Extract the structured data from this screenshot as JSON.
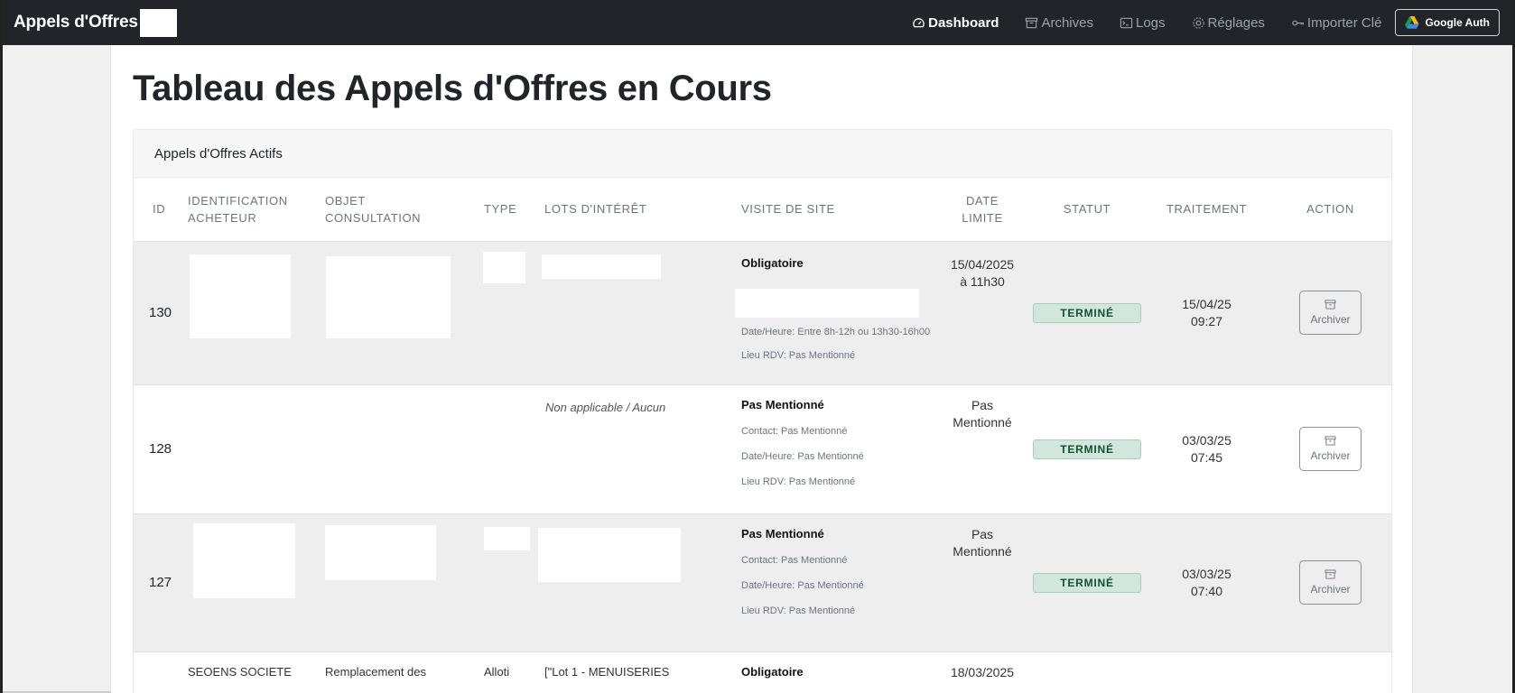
{
  "navbar": {
    "brand": "Appels d'Offres",
    "links": [
      {
        "label": "Dashboard",
        "icon": "dashboard-icon"
      },
      {
        "label": "Archives",
        "icon": "archive-icon"
      },
      {
        "label": "Logs",
        "icon": "terminal-icon"
      },
      {
        "label": "Réglages",
        "icon": "gear-icon"
      },
      {
        "label": "Importer Clé",
        "icon": "key-icon"
      }
    ],
    "google_auth": "Google Auth"
  },
  "page_title": "Tableau des Appels d'Offres en Cours",
  "card_title": "Appels d'Offres Actifs",
  "table": {
    "headers": {
      "id": "ID",
      "identification_line1": "IDENTIFICATION",
      "identification_line2": "ACHETEUR",
      "objet_line1": "OBJET",
      "objet_line2": "CONSULTATION",
      "type": "TYPE",
      "lots": "LOTS D'INTÉRÊT",
      "visite": "VISITE DE SITE",
      "date_line1": "DATE",
      "date_line2": "LIMITE",
      "statut": "STATUT",
      "traitement": "TRAITEMENT",
      "action": "ACTION"
    },
    "rows": [
      {
        "id": "130",
        "lots": "",
        "visite_title": "Obligatoire",
        "visite_lines": [
          "Date/Heure: Entre 8h-12h ou 13h30-16h00",
          "Lieu RDV: Pas Mentionné"
        ],
        "date_line1": "15/04/2025",
        "date_line2": "à 11h30",
        "statut": "TERMINÉ",
        "traitement_line1": "15/04/25",
        "traitement_line2": "09:27",
        "action": "Archiver"
      },
      {
        "id": "128",
        "lots": "Non applicable / Aucun",
        "visite_title": "Pas Mentionné",
        "visite_lines": [
          "Contact: Pas Mentionné",
          "Date/Heure: Pas Mentionné",
          "Lieu RDV: Pas Mentionné"
        ],
        "date_line1": "Pas",
        "date_line2": "Mentionné",
        "statut": "TERMINÉ",
        "traitement_line1": "03/03/25",
        "traitement_line2": "07:45",
        "action": "Archiver"
      },
      {
        "id": "127",
        "lots": "",
        "visite_title": "Pas Mentionné",
        "visite_lines": [
          "Contact: Pas Mentionné",
          "Date/Heure: Pas Mentionné",
          "Lieu RDV: Pas Mentionné"
        ],
        "date_line1": "Pas",
        "date_line2": "Mentionné",
        "statut": "TERMINÉ",
        "traitement_line1": "03/03/25",
        "traitement_line2": "07:40",
        "action": "Archiver"
      },
      {
        "identification": "SEOENS SOCIETE",
        "objet": "Remplacement des",
        "type": "Alloti",
        "lots": "[\"Lot 1 - MENUISERIES",
        "visite_title": "Obligatoire",
        "date_line1": "18/03/2025"
      }
    ]
  },
  "colors": {
    "navbar_bg": "#212529",
    "badge_bg": "#d1e7dd",
    "badge_text": "#0f5132",
    "row_gray": "#eeeeee"
  }
}
